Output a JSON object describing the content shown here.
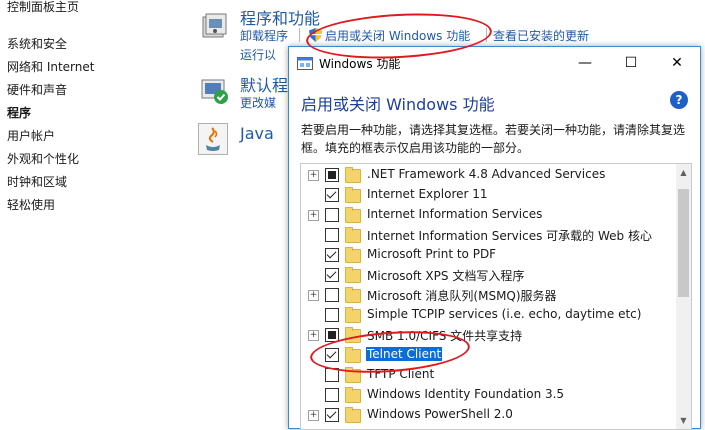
{
  "leftnav": {
    "home": "控制面板主页",
    "items": [
      {
        "label": "系统和安全",
        "active": false
      },
      {
        "label": "网络和 Internet",
        "active": false
      },
      {
        "label": "硬件和声音",
        "active": false
      },
      {
        "label": "程序",
        "active": true
      },
      {
        "label": "用户帐户",
        "active": false
      },
      {
        "label": "外观和个性化",
        "active": false
      },
      {
        "label": "时钟和区域",
        "active": false
      },
      {
        "label": "轻松使用",
        "active": false
      }
    ]
  },
  "programs": {
    "title": "程序和功能",
    "link_uninstall": "卸载程序",
    "link_toggle_features": "启用或关闭 Windows 功能",
    "link_view_updates": "查看已安装的更新",
    "link_run": "运行以"
  },
  "defaults": {
    "title": "默认程",
    "link": "更改媒"
  },
  "java": {
    "title": "Java"
  },
  "dialog": {
    "title": "Windows 功能",
    "minimize": "—",
    "maximize": "☐",
    "close": "✕",
    "heading": "启用或关闭 Windows 功能",
    "help": "?",
    "description": "若要启用一种功能，请选择其复选框。若要关闭一种功能，请清除其复选框。填充的框表示仅启用该功能的一部分。",
    "features": [
      {
        "label": ".NET Framework 4.8 Advanced Services",
        "state": "partial",
        "expandable": true,
        "selected": false
      },
      {
        "label": "Internet Explorer 11",
        "state": "checked",
        "expandable": false,
        "selected": false
      },
      {
        "label": "Internet Information Services",
        "state": "unchecked",
        "expandable": true,
        "selected": false
      },
      {
        "label": "Internet Information Services 可承载的 Web 核心",
        "state": "unchecked",
        "expandable": false,
        "selected": false
      },
      {
        "label": "Microsoft Print to PDF",
        "state": "checked",
        "expandable": false,
        "selected": false
      },
      {
        "label": "Microsoft XPS 文档写入程序",
        "state": "checked",
        "expandable": false,
        "selected": false
      },
      {
        "label": "Microsoft 消息队列(MSMQ)服务器",
        "state": "unchecked",
        "expandable": true,
        "selected": false
      },
      {
        "label": "Simple TCPIP services (i.e. echo, daytime etc)",
        "state": "unchecked",
        "expandable": false,
        "selected": false
      },
      {
        "label": "SMB 1.0/CIFS 文件共享支持",
        "state": "partial",
        "expandable": true,
        "selected": false
      },
      {
        "label": "Telnet Client",
        "state": "checked",
        "expandable": false,
        "selected": true
      },
      {
        "label": "TFTP Client",
        "state": "unchecked",
        "expandable": false,
        "selected": false
      },
      {
        "label": "Windows Identity Foundation 3.5",
        "state": "unchecked",
        "expandable": false,
        "selected": false
      },
      {
        "label": "Windows PowerShell 2.0",
        "state": "checked",
        "expandable": true,
        "selected": false
      }
    ]
  },
  "colors": {
    "link": "#1e5aa8",
    "selection": "#0a6dd8",
    "annotation": "#e0191e"
  }
}
